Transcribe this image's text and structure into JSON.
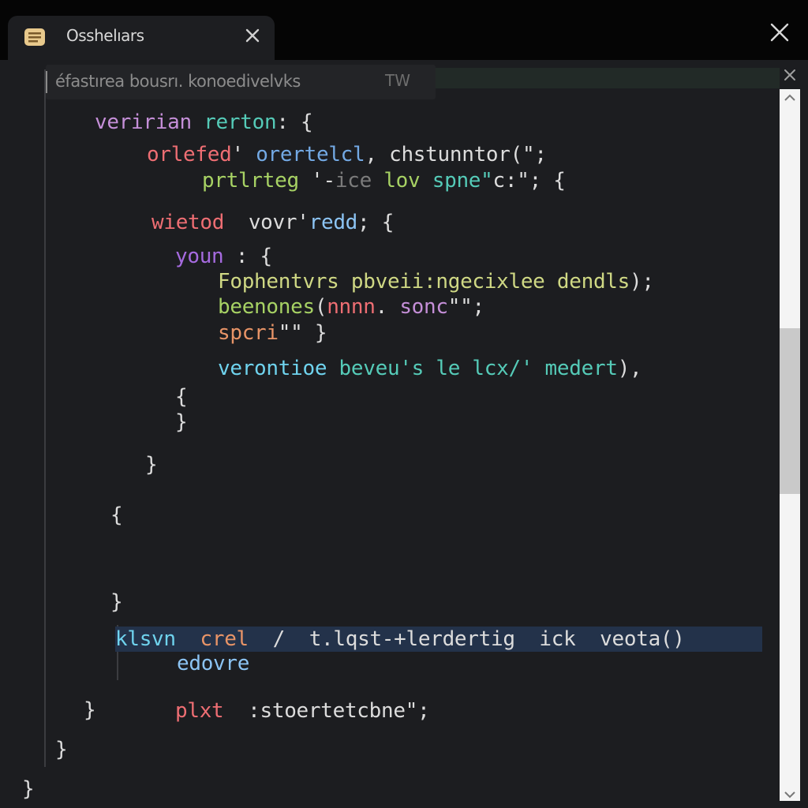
{
  "tab": {
    "title": "Osshelıars",
    "icon": "notes-icon",
    "close_icon": "close-icon"
  },
  "window": {
    "close_icon": "close-icon"
  },
  "find": {
    "query": "éfastırea bousrı. konoedivelvks",
    "match_label": "TW",
    "close_icon": "close-icon"
  },
  "scrollbar": {
    "up_icon": "chevron-up-icon",
    "down_icon": "chevron-down-icon",
    "position": 0.34
  },
  "colors": {
    "background": "#1c1d20",
    "tab": "#1d1e21",
    "current_line": "#23324a",
    "scroll_track": "#f4f4f4",
    "scroll_thumb": "#c9c9c9"
  },
  "code": {
    "lines": [
      {
        "tokens": [
          {
            "t": "veririan ",
            "c": "purple"
          },
          {
            "t": "rerton",
            "c": "teal"
          },
          {
            "t": ": {",
            "c": "white"
          }
        ]
      },
      {
        "tokens": [
          {
            "t": "orlefed",
            "c": "red"
          },
          {
            "t": "' ",
            "c": "white"
          },
          {
            "t": "orertelcl",
            "c": "blue"
          },
          {
            "t": ", chstunntor(\";",
            "c": "white"
          }
        ]
      },
      {
        "tokens": [
          {
            "t": "prtlrteg",
            "c": "green"
          },
          {
            "t": " '-",
            "c": "white"
          },
          {
            "t": "ice ",
            "c": "gray"
          },
          {
            "t": "lov ",
            "c": "green"
          },
          {
            "t": "spne\"",
            "c": "teal"
          },
          {
            "t": "c:\"; {",
            "c": "white"
          }
        ]
      },
      {
        "tokens": [
          {
            "t": "wietod",
            "c": "red"
          },
          {
            "t": "  vovr'",
            "c": "white"
          },
          {
            "t": "redd",
            "c": "skyblue"
          },
          {
            "t": "; {",
            "c": "white"
          }
        ]
      },
      {
        "tokens": [
          {
            "t": "youn",
            "c": "violet"
          },
          {
            "t": " : {",
            "c": "white"
          }
        ]
      },
      {
        "tokens": [
          {
            "t": "Fophentvrs pbveii:ngecixlee dendls",
            "c": "yellow"
          },
          {
            "t": ");",
            "c": "white"
          }
        ]
      },
      {
        "tokens": [
          {
            "t": "beenones",
            "c": "green"
          },
          {
            "t": "(",
            "c": "white"
          },
          {
            "t": "nnnn",
            "c": "red"
          },
          {
            "t": ". ",
            "c": "white"
          },
          {
            "t": "sonc",
            "c": "purple"
          },
          {
            "t": "\"\";",
            "c": "white"
          }
        ]
      },
      {
        "tokens": [
          {
            "t": "spcri",
            "c": "orange"
          },
          {
            "t": "\"\" }",
            "c": "white"
          }
        ]
      },
      {
        "tokens": [
          {
            "t": "verontioe ",
            "c": "cyan"
          },
          {
            "t": "beveu's le lcx/' medert",
            "c": "teal"
          },
          {
            "t": "), ",
            "c": "white"
          }
        ]
      },
      {
        "tokens": [
          {
            "t": "{",
            "c": "white"
          }
        ]
      },
      {
        "tokens": [
          {
            "t": "}",
            "c": "white"
          }
        ]
      },
      {
        "tokens": [
          {
            "t": "}",
            "c": "white"
          }
        ]
      },
      {
        "tokens": [
          {
            "t": "{",
            "c": "white"
          }
        ]
      },
      {
        "tokens": [
          {
            "t": "}",
            "c": "white"
          }
        ]
      },
      {
        "tokens": [
          {
            "t": "klsvn",
            "c": "cyan"
          },
          {
            "t": "  ",
            "c": "white"
          },
          {
            "t": "crel",
            "c": "orange"
          },
          {
            "t": "  /  t.lqst-+lerdertig  ick  veota()",
            "c": "white"
          }
        ]
      },
      {
        "tokens": [
          {
            "t": "edovre",
            "c": "skyblue"
          }
        ]
      },
      {
        "tokens": [
          {
            "t": "}",
            "c": "white"
          }
        ]
      },
      {
        "tokens": [
          {
            "t": "plxt",
            "c": "red"
          },
          {
            "t": "  :stoertetcbne\";",
            "c": "white"
          }
        ]
      },
      {
        "tokens": [
          {
            "t": "}",
            "c": "white"
          }
        ]
      },
      {
        "tokens": [
          {
            "t": "}",
            "c": "white"
          }
        ]
      }
    ]
  }
}
